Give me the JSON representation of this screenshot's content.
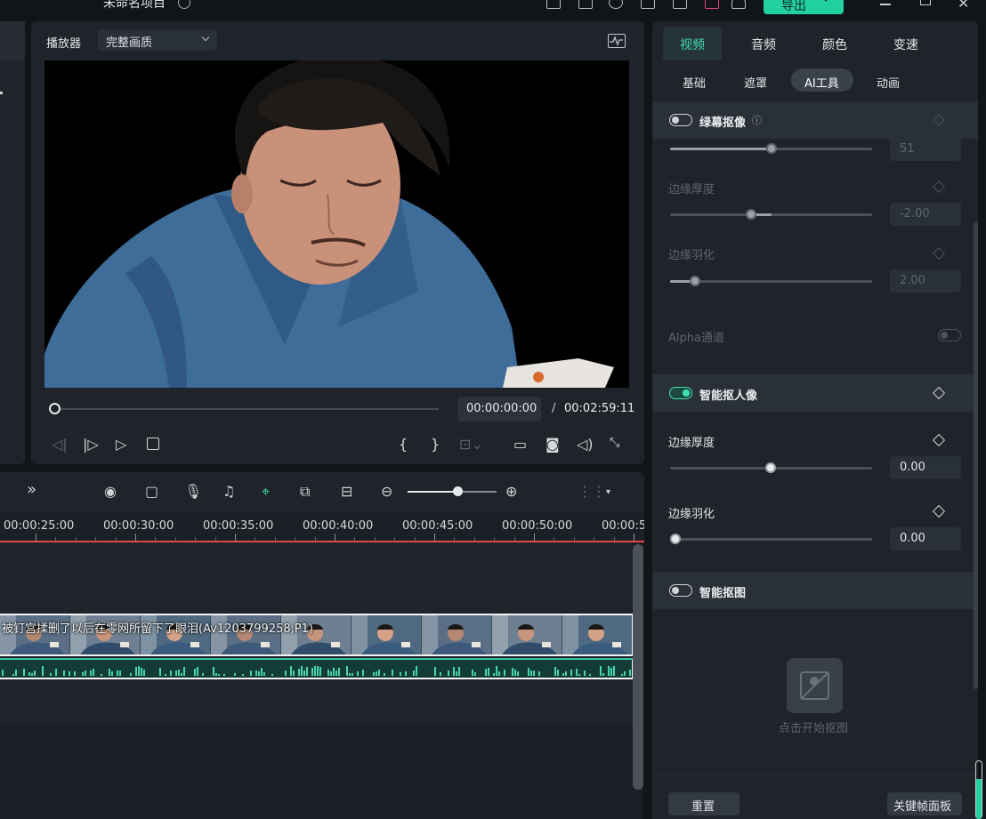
{
  "titlebar": {
    "project_name": "未命名项目",
    "export_label": "导出"
  },
  "player": {
    "label": "播放器",
    "quality": "完整画质",
    "timecode_current": "00:00:00:00",
    "timecode_separator": "/",
    "timecode_total": "00:02:59:11",
    "playhead_progress": 0.0
  },
  "timeline": {
    "ruler_labels": [
      "00:00:25:00",
      "00:00:30:00",
      "00:00:35:00",
      "00:00:40:00",
      "00:00:45:00",
      "00:00:50:00",
      "00:00:5"
    ],
    "clip_title": "被钉宫揉删了以后在零网所留下了眼泪(Av1203799258,P1)"
  },
  "right_panel": {
    "tabs": [
      "视频",
      "音频",
      "颜色",
      "变速"
    ],
    "active_tab": "视频",
    "subtabs": [
      "基础",
      "遮罩",
      "AI工具",
      "动画"
    ],
    "active_subtab": "AI工具",
    "chroma_key": {
      "title": "绿幕抠像",
      "enabled": false,
      "top_value": "51",
      "edge_thickness_label": "边缘厚度",
      "edge_thickness_value": "-2.00",
      "edge_feather_label": "边缘羽化",
      "edge_feather_value": "2.00",
      "alpha_label": "Alpha通道"
    },
    "smart_cutout": {
      "title": "智能抠人像",
      "enabled": true,
      "edge_thickness_label": "边缘厚度",
      "edge_thickness_value": "0.00",
      "edge_feather_label": "边缘羽化",
      "edge_feather_value": "0.00"
    },
    "ai_matte": {
      "title": "智能抠图",
      "enabled": false,
      "hint": "点击开始抠图"
    },
    "reset_label": "重置",
    "keyframe_panel_label": "关键帧面板"
  },
  "colors": {
    "accent": "#22d0a2",
    "playhead": "#e04848",
    "background": "#1f242b"
  }
}
